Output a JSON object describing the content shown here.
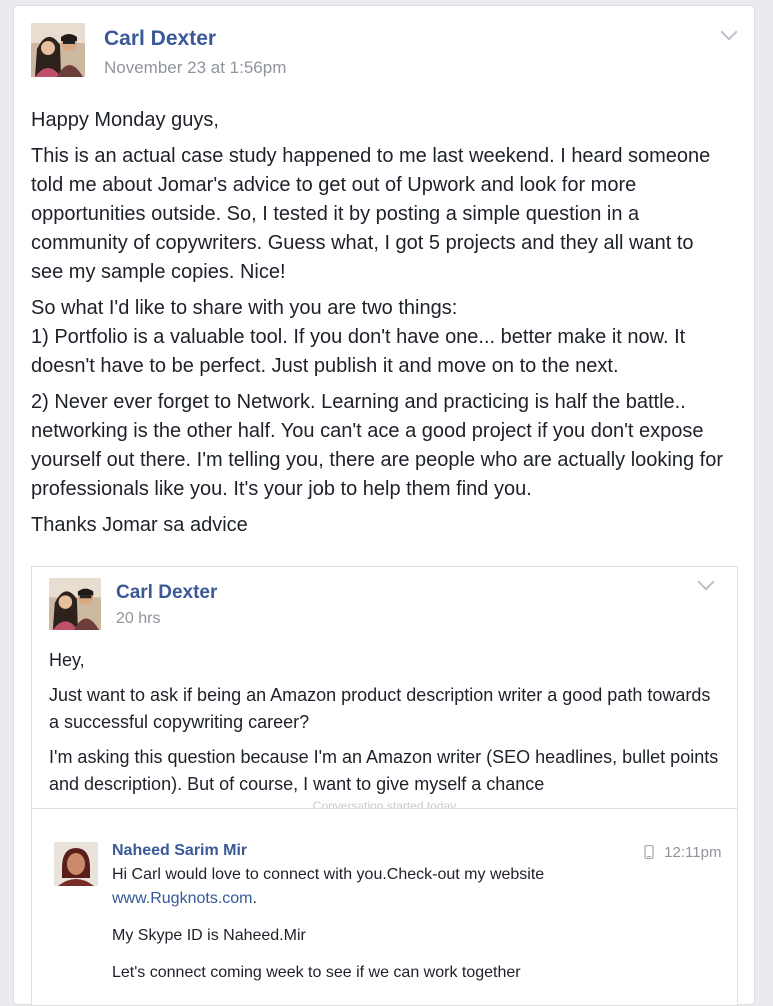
{
  "post": {
    "author": "Carl Dexter",
    "timestamp": "November 23 at 1:56pm",
    "paragraphs": [
      "Happy Monday guys,",
      "This is an actual case study happened to me last weekend. I heard someone told me about Jomar's advice to get out of Upwork and look for more opportunities outside. So, I tested it by posting a simple question in a community of copywriters. Guess what, I got 5 projects and they all want to see my sample copies. Nice!",
      "So what I'd like to share with you are two things:",
      "1) Portfolio is a valuable tool. If you don't have one... better make it now. It doesn't have to be perfect. Just publish it and move on to the next.",
      "2) Never ever forget to Network. Learning and practicing is half the battle.. networking is the other half. You can't ace a good project if you don't expose yourself out there. I'm telling you, there are people who are actually looking for professionals like you. It's your job to help them find you.",
      "Thanks Jomar sa advice"
    ]
  },
  "shared_post": {
    "author": "Carl Dexter",
    "timestamp": "20 hrs",
    "paragraphs": [
      "Hey,",
      "Just want to ask if being an Amazon product description writer a good path towards a successful copywriting career?",
      "I'm asking this question because I'm an Amazon writer (SEO headlines, bullet points and description). But of course, I want to give myself a chance"
    ],
    "divider_note": "Conversation started today"
  },
  "message": {
    "sender": "Naheed Sarim Mir",
    "time": "12:11pm",
    "line1": "Hi Carl would love to connect with you.Check-out my website",
    "link": "www.Rugknots.com",
    "link_suffix": ".",
    "line2": "My Skype ID is Naheed.Mir",
    "line3": "Let's connect coming week to see if we can work together"
  },
  "icons": {
    "options": "chevron-down-icon",
    "device": "mobile-phone-icon"
  },
  "colors": {
    "link": "#3b5998",
    "meta": "#90949c",
    "background": "#e9ebee"
  }
}
